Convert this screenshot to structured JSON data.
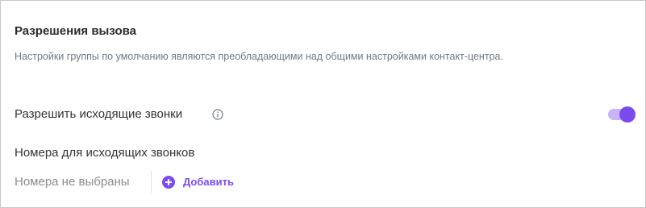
{
  "section": {
    "title": "Разрешения вызова",
    "subtitle": "Настройки группы по умолчанию являются преобладающими над общими настройками контакт-центра."
  },
  "outgoing_calls": {
    "label": "Разрешить исходящие звонки",
    "info_icon": "info-icon",
    "enabled": true,
    "accent_color": "#7b4bf0"
  },
  "outgoing_numbers": {
    "heading": "Номера для исходящих звонков",
    "empty_text": "Номера не выбраны",
    "add_label": "Добавить",
    "add_icon": "plus-circle-icon"
  }
}
